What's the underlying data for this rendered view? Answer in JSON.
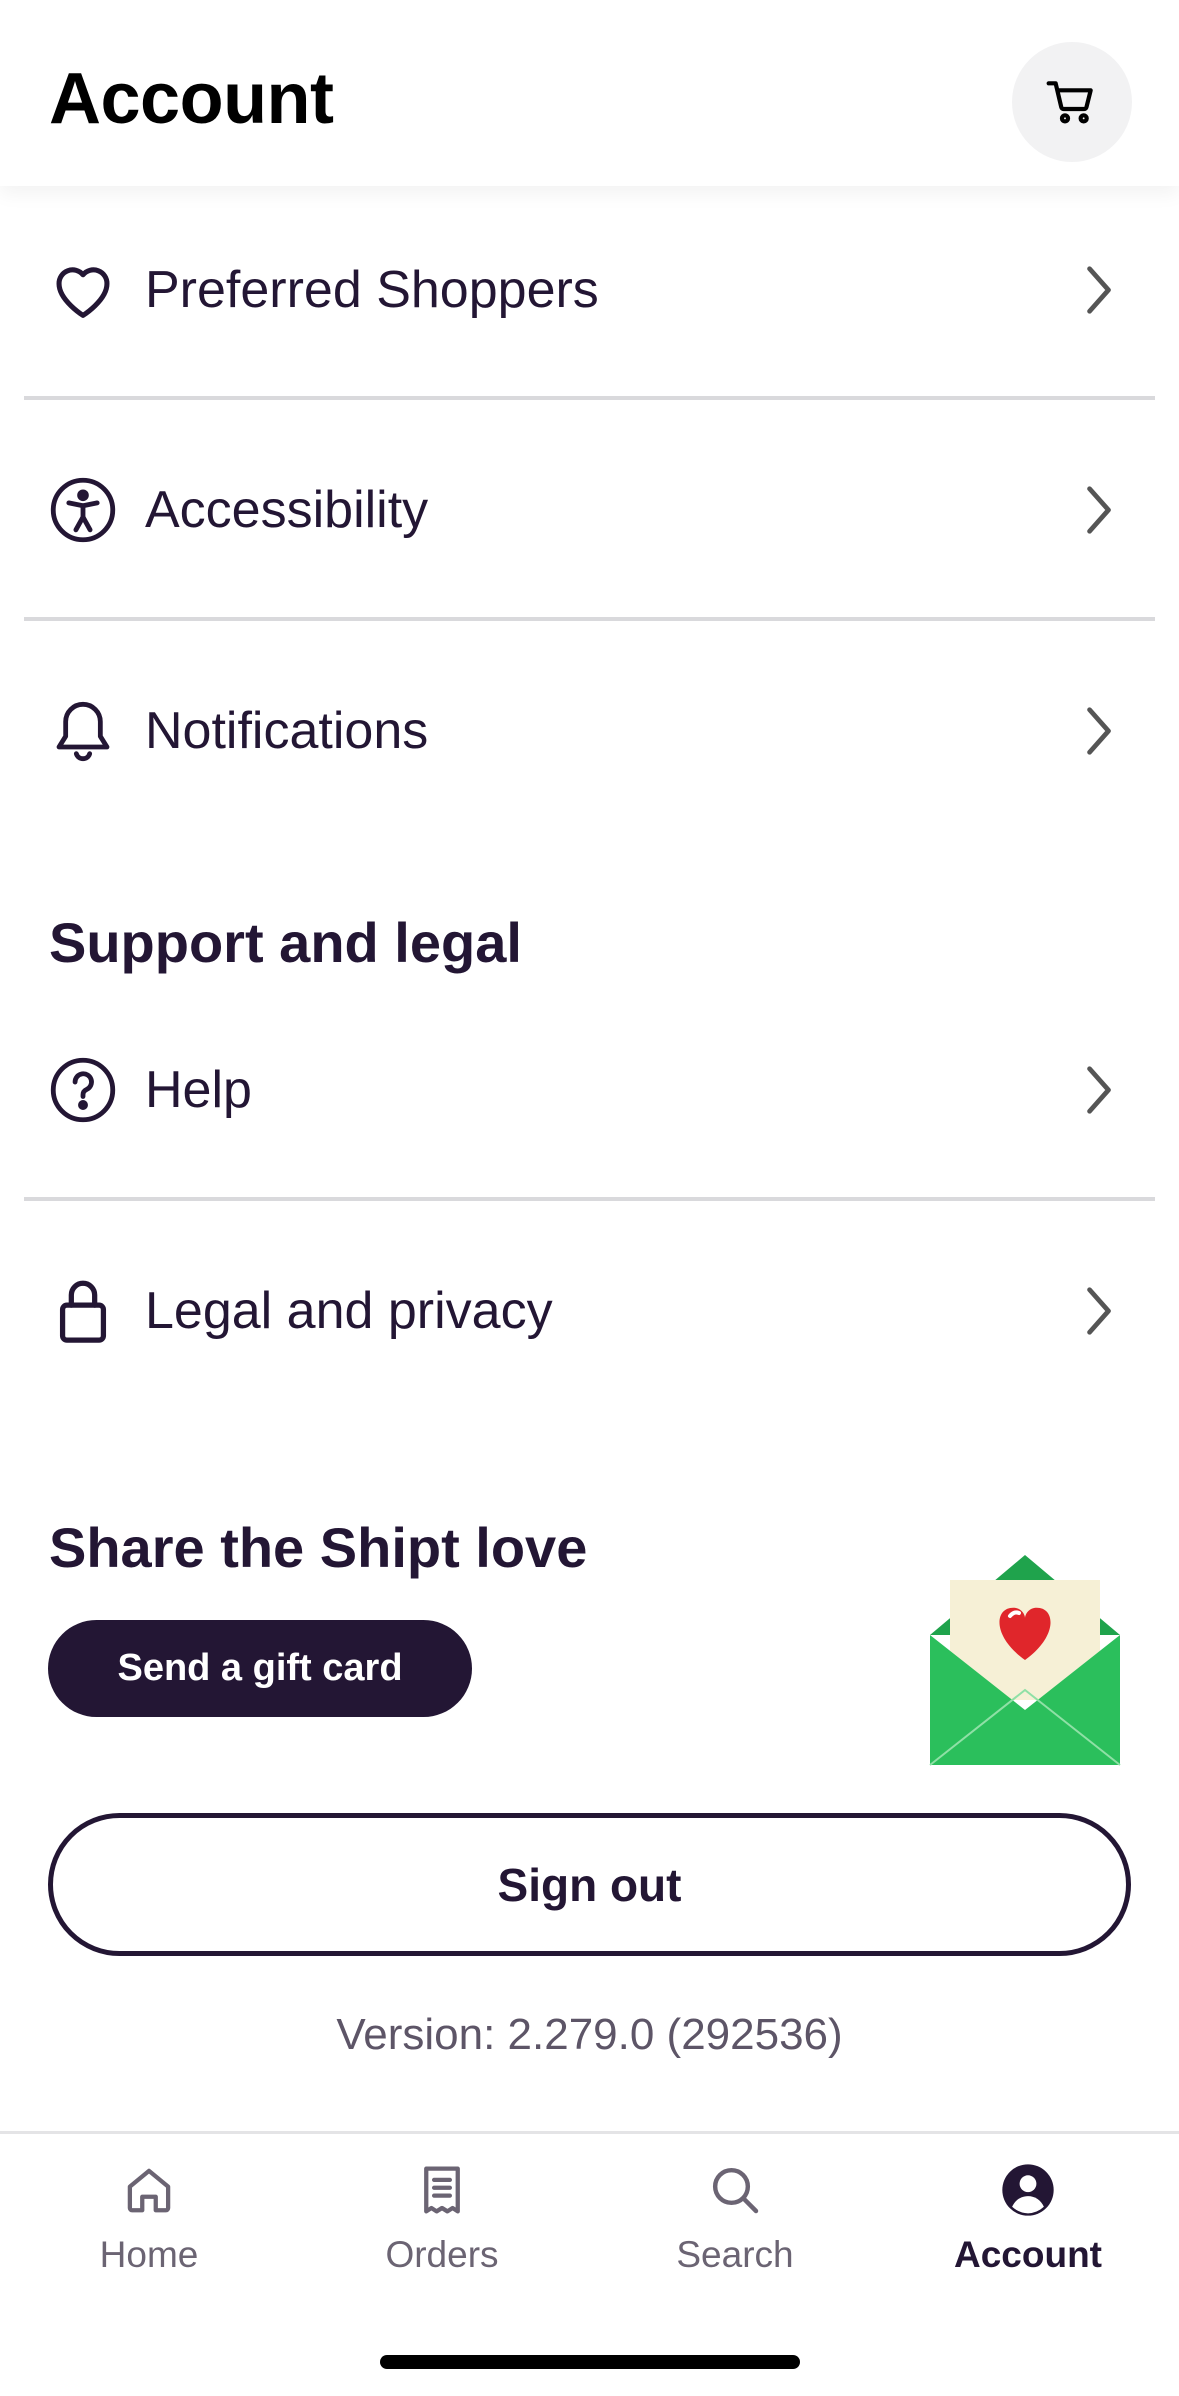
{
  "header": {
    "title": "Account",
    "cart_icon": "cart-icon"
  },
  "menu_group_1": [
    {
      "label": "Preferred Shoppers",
      "icon": "heart-icon"
    },
    {
      "label": "Accessibility",
      "icon": "accessibility-icon"
    },
    {
      "label": "Notifications",
      "icon": "bell-icon"
    }
  ],
  "support": {
    "title": "Support and legal",
    "items": [
      {
        "label": "Help",
        "icon": "help-icon"
      },
      {
        "label": "Legal and privacy",
        "icon": "lock-icon"
      }
    ]
  },
  "share": {
    "title": "Share the Shipt love",
    "gift_button": "Send a gift card",
    "illustration": "envelope-heart-icon"
  },
  "sign_out_label": "Sign out",
  "version": "Version: 2.279.0 (292536)",
  "tabbar": {
    "items": [
      {
        "label": "Home",
        "icon": "home-icon",
        "active": false
      },
      {
        "label": "Orders",
        "icon": "receipt-icon",
        "active": false
      },
      {
        "label": "Search",
        "icon": "search-icon",
        "active": false
      },
      {
        "label": "Account",
        "icon": "account-icon",
        "active": true
      }
    ]
  },
  "colors": {
    "primary": "#231634",
    "divider": "#d9d9dc",
    "envelope_green": "#2bbf5c",
    "heart_red": "#e0262b"
  }
}
